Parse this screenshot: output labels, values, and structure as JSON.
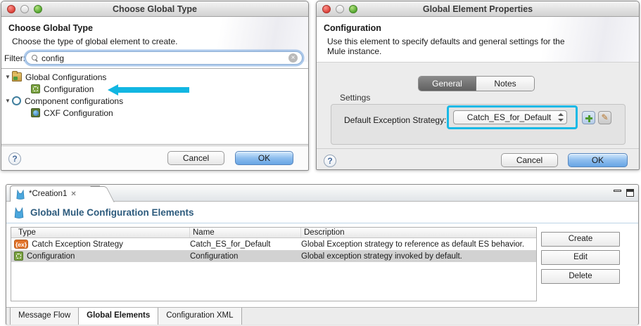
{
  "colors": {
    "accent_cyan": "#12b6e2",
    "selection_grey": "#d2d2d2",
    "ok_blue": "#68a5e4",
    "ex_orange": "#e2742b",
    "config_green": "#7aa23f",
    "header_blue": "#2d5b7d"
  },
  "icons": {
    "clear_glyph": "×",
    "pencil_glyph": "✎",
    "close_glyph": "✕",
    "twisty_glyph": "▼"
  },
  "d1": {
    "window_title": "Choose Global Type",
    "heading": "Choose Global Type",
    "subtitle": "Choose the type of global element to create.",
    "filter_label": "Filter:",
    "filter_value": "config",
    "tree": [
      {
        "label": "Global Configurations"
      },
      {
        "label": "Configuration"
      },
      {
        "label": "Component configurations"
      },
      {
        "label": "CXF Configuration"
      }
    ],
    "help": "?",
    "cancel": "Cancel",
    "ok": "OK"
  },
  "d2": {
    "window_title": "Global Element Properties",
    "heading": "Configuration",
    "subtitle": "Use this element to specify defaults and general settings for the Mule instance.",
    "tab_general": "General",
    "tab_notes": "Notes",
    "settings_label": "Settings",
    "field_label": "Default Exception Strategy:",
    "field_value": "Catch_ES_for_Default",
    "help": "?",
    "cancel": "Cancel",
    "ok": "OK"
  },
  "editor": {
    "tab_title": "*Creation1",
    "heading": "Global Mule Configuration Elements",
    "columns": [
      "Type",
      "Name",
      "Description"
    ],
    "ex_badge": "{ex}",
    "rows": [
      {
        "type": "Catch Exception Strategy",
        "name": "Catch_ES_for_Default",
        "description": "Global Exception strategy to reference as default ES behavior."
      },
      {
        "type": "Configuration",
        "name": "Configuration",
        "description": "Global exception strategy invoked by default."
      }
    ],
    "buttons": [
      "Create",
      "Edit",
      "Delete"
    ],
    "bottom_tabs": [
      "Message Flow",
      "Global Elements",
      "Configuration XML"
    ]
  }
}
